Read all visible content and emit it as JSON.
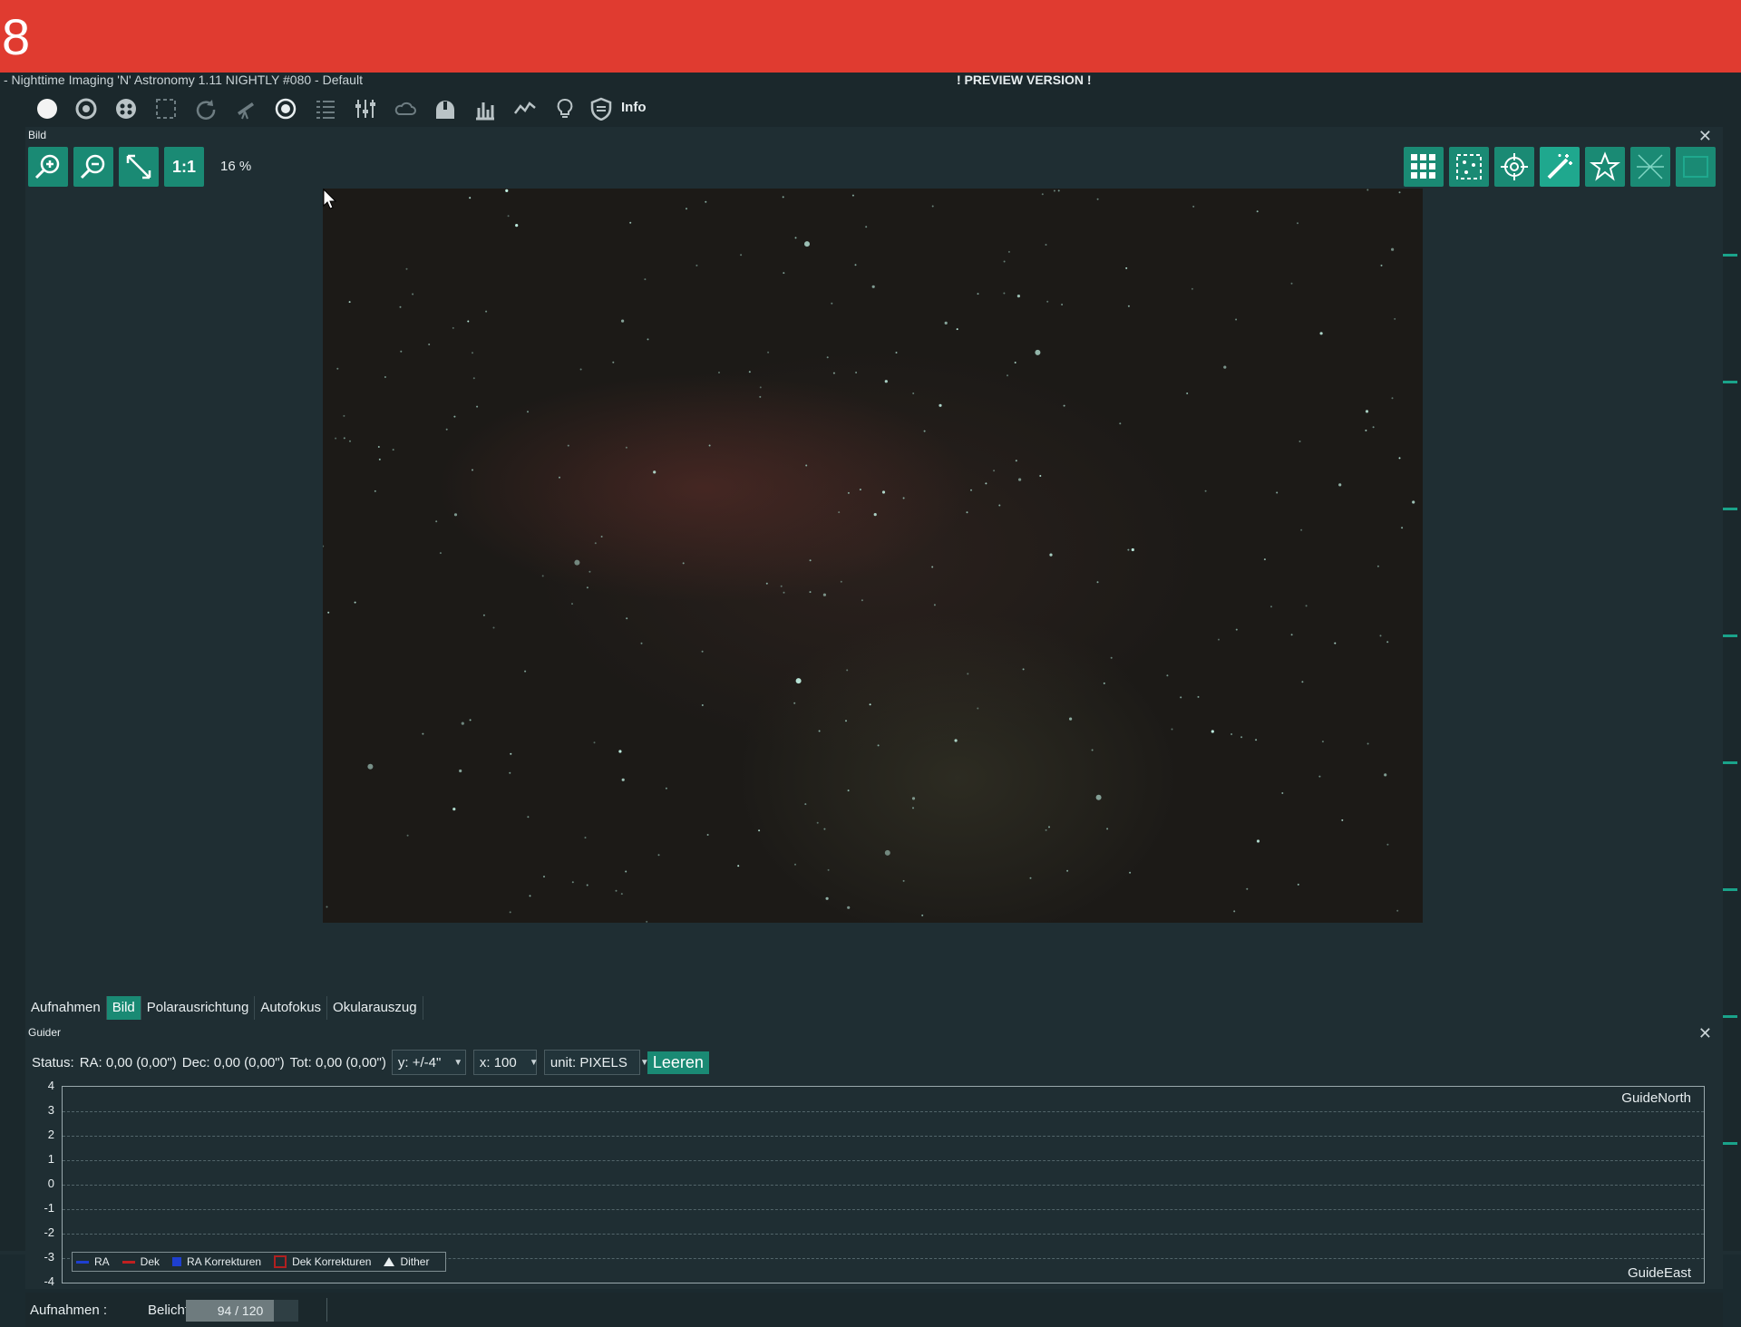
{
  "banner": {
    "number": "8"
  },
  "window": {
    "title": "- Nighttime Imaging 'N' Astronomy 1.11 NIGHTLY #080  -  Default",
    "preview_label": "! PREVIEW VERSION !"
  },
  "toolbar": {
    "info_label": "Info"
  },
  "image_panel": {
    "header": "Bild",
    "zoom_1to1_label": "1:1",
    "zoom_level": "16 %"
  },
  "tabs": [
    "Aufnahmen",
    "Bild",
    "Polarausrichtung",
    "Autofokus",
    "Okularauszug"
  ],
  "guider": {
    "header": "Guider",
    "status_label": "Status:",
    "ra": "RA: 0,00 (0,00\")",
    "dec": "Dec: 0,00 (0,00\")",
    "tot": "Tot: 0,00 (0,00\")",
    "y_select": "y: +/-4\"",
    "x_select": "x: 100",
    "unit_select": "unit: PIXELS",
    "clear_button": "Leeren",
    "y_ticks": [
      "4",
      "3",
      "2",
      "1",
      "0",
      "-1",
      "-2",
      "-3",
      "-4"
    ],
    "guide_north": "GuideNorth",
    "guide_east": "GuideEast",
    "legend": {
      "ra": "RA",
      "dek": "Dek",
      "ra_korrekturen": "RA Korrekturen",
      "dek_korrekturen": "Dek Korrekturen",
      "dither": "Dither"
    }
  },
  "bottom": {
    "aufnahmen": "Aufnahmen :",
    "belichten": "Belichten",
    "progress": "94 / 120",
    "progress_fraction": 0.783
  },
  "colors": {
    "accent": "#1a8a74",
    "banner": "#e03b30",
    "ra": "#1e3fd0",
    "dek": "#c02020"
  }
}
